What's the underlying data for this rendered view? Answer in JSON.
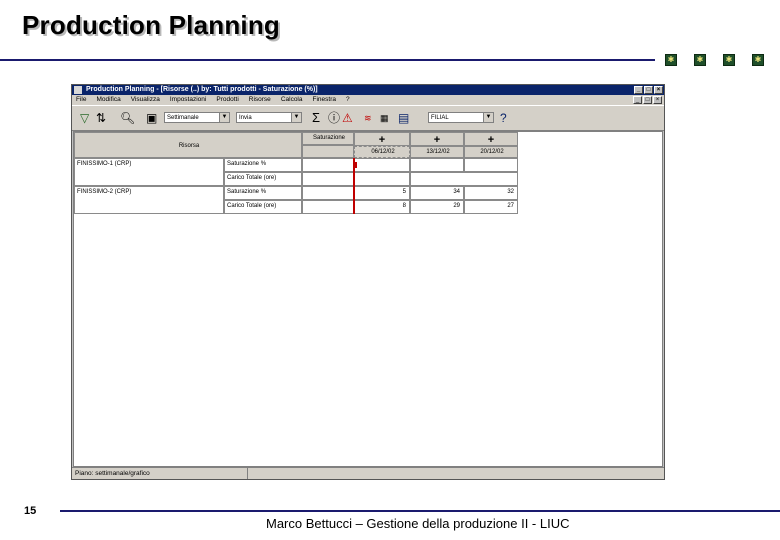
{
  "slide": {
    "title": "Production Planning",
    "page_number": "15",
    "footer": "Marco Bettucci – Gestione della produzione II - LIUC"
  },
  "window": {
    "title": "Production Planning - [Risorse (..) by: Tutti prodotti - Saturazione (%)]",
    "menu": [
      "File",
      "Modifica",
      "Visualizza",
      "Impostazioni",
      "Prodotti",
      "Risorse",
      "Calcola",
      "Finestra",
      "?"
    ],
    "toolbar": {
      "combo1": "Settimanale",
      "combo2": "Invia",
      "combo3": "FILIAL"
    },
    "status": {
      "text": "Piano: settimanale/grafico"
    }
  },
  "grid": {
    "corner_label": "Risorsa",
    "filter_label": "Saturazione",
    "periods": [
      "06/12/02",
      "13/12/02",
      "20/12/02"
    ],
    "rows": [
      {
        "resource": "FINISSIMO-1 (CRP)",
        "metrics": [
          {
            "label": "Saturazione %",
            "values": [
              "",
              "",
              ""
            ]
          },
          {
            "label": "Carico Totale (ore)",
            "values": [
              "",
              "",
              ""
            ]
          }
        ]
      },
      {
        "resource": "FINISSIMO-2 (CRP)",
        "metrics": [
          {
            "label": "Saturazione %",
            "values": [
              "5",
              "34",
              "32"
            ]
          },
          {
            "label": "Carico Totale (ore)",
            "values": [
              "8",
              "29",
              "27"
            ]
          }
        ]
      }
    ]
  },
  "colors": {
    "title_rule": "#1a1a6e",
    "window_title": "#0a246a",
    "marker": "#c00000"
  }
}
